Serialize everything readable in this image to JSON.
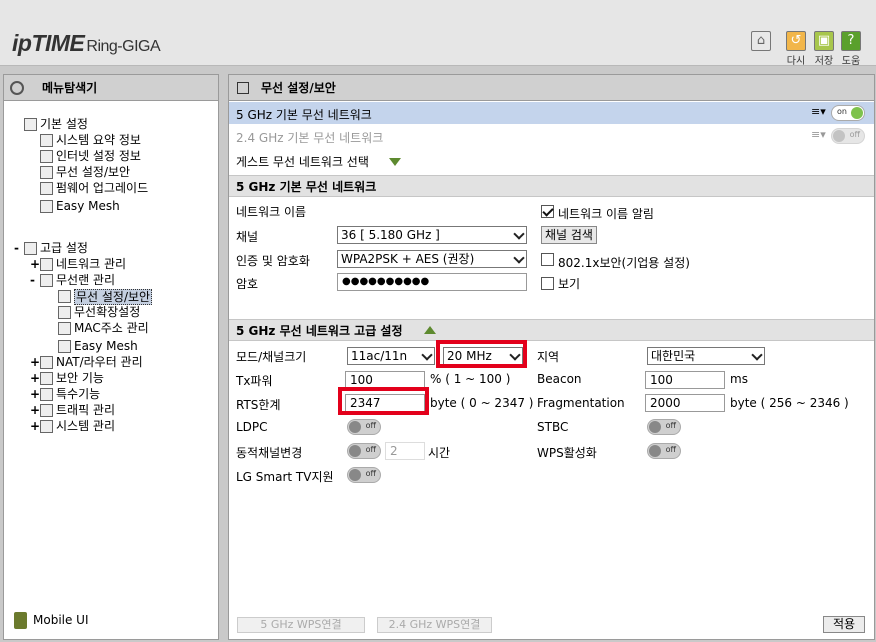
{
  "header": {
    "logo_brand": "ipTIME",
    "logo_model": "Ring-GIGA",
    "btn_refresh": "다시",
    "btn_save": "저장",
    "btn_help": "도움"
  },
  "sidebar": {
    "title": "메뉴탐색기",
    "basic": "기본 설정",
    "basic_items": [
      "시스템 요약 정보",
      "인터넷 설정 정보",
      "무선 설정/보안",
      "펌웨어 업그레이드",
      "Easy Mesh"
    ],
    "advanced": "고급 설정",
    "adv_network": "네트워크 관리",
    "adv_wireless": "무선랜 관리",
    "wireless_items": [
      "무선 설정/보안",
      "무선확장설정",
      "MAC주소 관리",
      "Easy Mesh"
    ],
    "adv_nat": "NAT/라우터 관리",
    "adv_security": "보안 기능",
    "adv_special": "특수기능",
    "adv_traffic": "트래픽 관리",
    "adv_system": "시스템 관리",
    "expanders": [
      "-",
      "+",
      "-",
      "+",
      "+",
      "+",
      "+",
      "+"
    ],
    "mobile": "Mobile UI"
  },
  "main": {
    "title": "무선 설정/보안",
    "net5": "5 GHz 기본 무선 네트워크",
    "net24": "2.4 GHz 기본 무선 네트워크",
    "guest": "게스트 무선 네트워크 선택",
    "toggle_on": "on",
    "toggle_off": "off",
    "basic_section": "5 GHz 기본 무선 네트워크",
    "lbl_netname": "네트워크 이름",
    "lbl_broadcast": "네트워크 이름 알림",
    "lbl_channel": "채널",
    "channel_value": "36 [ 5.180 GHz ]",
    "btn_channel_search": "채널 검색",
    "lbl_auth": "인증 및 암호화",
    "auth_value": "WPA2PSK + AES (권장)",
    "lbl_8021x": "802.1x보안(기업용 설정)",
    "lbl_password": "암호",
    "password_value": "●●●●●●●●●●",
    "lbl_show": "보기",
    "adv_section": "5 GHz 무선 네트워크 고급 설정",
    "lbl_mode": "모드/채널크기",
    "mode_value": "11ac/11n",
    "width_value": "20 MHz",
    "lbl_region": "지역",
    "region_value": "대한민국",
    "lbl_txpower": "Tx파워",
    "txpower_value": "100",
    "txpower_range": "% ( 1 ~ 100 )",
    "lbl_beacon": "Beacon",
    "beacon_value": "100",
    "beacon_unit": "ms",
    "lbl_rts": "RTS한계",
    "rts_value": "2347",
    "rts_range": "byte ( 0 ~ 2347 )",
    "lbl_frag": "Fragmentation",
    "frag_value": "2000",
    "frag_range": "byte ( 256 ~ 2346 )",
    "lbl_ldpc": "LDPC",
    "lbl_stbc": "STBC",
    "lbl_dynch": "동적채널변경",
    "dynch_value": "2",
    "dynch_unit": "시간",
    "lbl_wps": "WPS활성화",
    "lbl_lgtv": "LG Smart TV지원",
    "btn_wps5": "5 GHz WPS연결",
    "btn_wps24": "2.4 GHz WPS연결",
    "btn_apply": "적용"
  },
  "colors": {
    "highlight": "#e3001b",
    "selected_row": "#c4d4ec",
    "toggle_on": "#7ec24c"
  }
}
